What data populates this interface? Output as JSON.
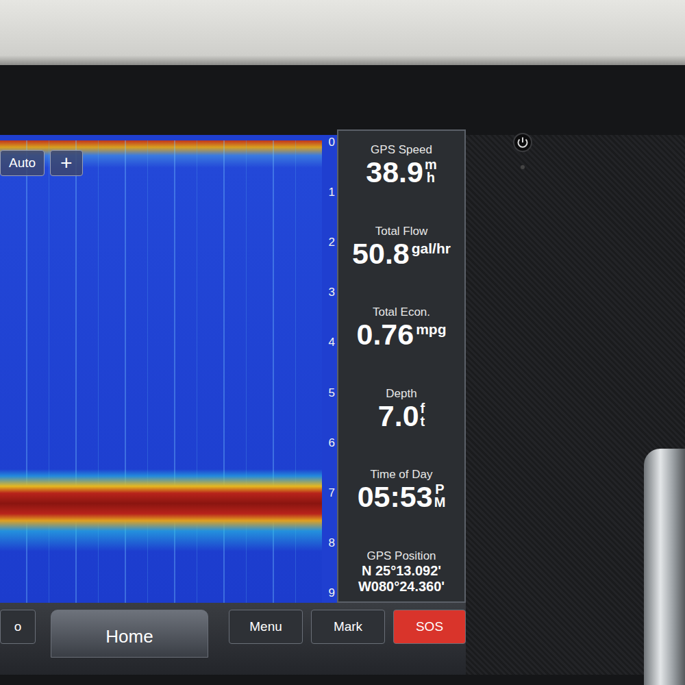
{
  "sonar_controls": [
    {
      "label": "Auto"
    },
    {
      "label": "+"
    }
  ],
  "depth_scale": [
    "0",
    "1",
    "2",
    "3",
    "4",
    "5",
    "6",
    "7",
    "8",
    "9"
  ],
  "fields": [
    {
      "label": "GPS Speed",
      "kind": "stacked",
      "value": "38.9",
      "unit": [
        "m",
        "h"
      ]
    },
    {
      "label": "Total Flow",
      "kind": "inline",
      "value": "50.8",
      "unit": [
        "gal/hr"
      ]
    },
    {
      "label": "Total Econ.",
      "kind": "inline",
      "value": "0.76",
      "unit": [
        "mpg"
      ]
    },
    {
      "label": "Depth",
      "kind": "stacked",
      "value": "7.0",
      "unit": [
        "f",
        "t"
      ]
    },
    {
      "label": "Time of Day",
      "kind": "stacked",
      "value": "05:53",
      "unit": [
        "P",
        "M"
      ]
    },
    {
      "label": "GPS Position",
      "kind": "lines",
      "lines": [
        "N  25°13.092'",
        "W080°24.360'"
      ]
    }
  ],
  "buttons": [
    {
      "label": "o",
      "selected": false,
      "color": "#2e3136"
    },
    {
      "label": "Home",
      "selected": true,
      "color": "#4a4e55"
    },
    {
      "label": "Menu",
      "selected": false,
      "color": "#2e3136"
    },
    {
      "label": "Mark",
      "selected": false,
      "color": "#2e3136"
    },
    {
      "label": "SOS",
      "selected": false,
      "color": "#d9342b"
    }
  ]
}
